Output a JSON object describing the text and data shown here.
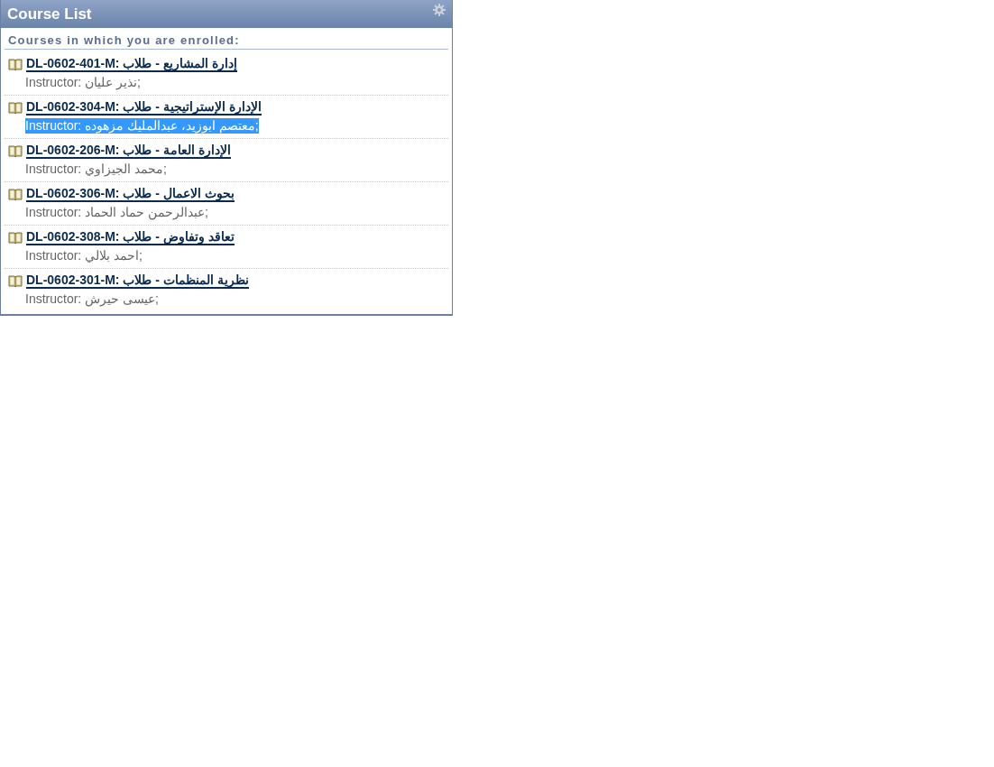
{
  "panel": {
    "title": "Course List",
    "heading": "Courses in which you are enrolled:"
  },
  "courses": [
    {
      "title": "DL-0602-401-M: إدارة المشاريع - طلاب",
      "instructor": "Instructor: نذير عليان;",
      "selected": false
    },
    {
      "title": "DL-0602-304-M: الإدارة الإستراتيجية - طلاب",
      "instructor": "Instructor: معتصم ابوزيد،  عبدالمليك مزهوده;",
      "selected": true
    },
    {
      "title": "DL-0602-206-M: الإدارة العامة - طلاب",
      "instructor": "Instructor: محمد الجيزاوي;",
      "selected": false
    },
    {
      "title": "DL-0602-306-M: بحوث الاعمال - طلاب",
      "instructor": "Instructor: عبدالرحمن حماد الحماد;",
      "selected": false
    },
    {
      "title": "DL-0602-308-M: تعاقد وتفاوض - طلاب",
      "instructor": "Instructor: احمد بلالي;",
      "selected": false
    },
    {
      "title": "DL-0602-301-M: نظرية المنظمات - طلاب",
      "instructor": "Instructor: عيسى حيرش;",
      "selected": false
    }
  ]
}
